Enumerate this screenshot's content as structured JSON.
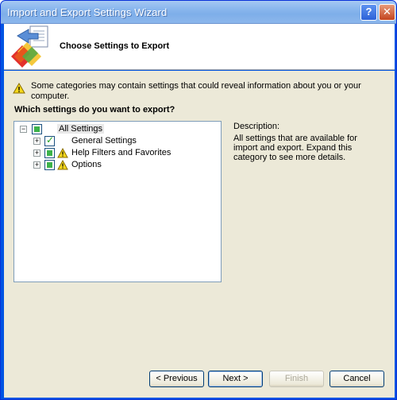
{
  "window": {
    "title": "Import and Export Settings Wizard",
    "help_button": "?",
    "close_button": "✕"
  },
  "header": {
    "title": "Choose Settings to Export"
  },
  "warning": {
    "text": "Some categories may contain settings that could reveal information about you or your computer."
  },
  "question": "Which settings do you want to export?",
  "tree": {
    "root": {
      "label": "All Settings",
      "expander": "−"
    },
    "children": [
      {
        "label": "General Settings",
        "expander": "+",
        "checked": true,
        "warning": false
      },
      {
        "label": "Help Filters and Favorites",
        "expander": "+",
        "checked": "partial",
        "warning": true
      },
      {
        "label": "Options",
        "expander": "+",
        "checked": "partial",
        "warning": true
      }
    ]
  },
  "description": {
    "title": "Description:",
    "text": "All settings that are available for import and export. Expand this category to see more details."
  },
  "buttons": {
    "previous": "< Previous",
    "next": "Next >",
    "finish": "Finish",
    "cancel": "Cancel"
  },
  "colors": {
    "title_bar": "#8ab7ee",
    "content_bg": "#ece9d8",
    "checkbox_fill": "#3cb34a",
    "warning_yellow": "#f5d81c"
  }
}
